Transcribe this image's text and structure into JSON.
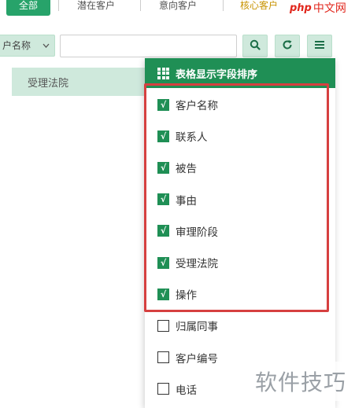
{
  "tabs": {
    "all": "全部",
    "potential": "潜在客户",
    "intent": "意向客户",
    "core": "核心客户"
  },
  "watermark_top": {
    "php": "php",
    "cn": "中文网"
  },
  "search": {
    "field_select": "户名称",
    "input_value": "",
    "search_icon": "search-icon",
    "refresh_icon": "refresh-icon",
    "columns_icon": "list-icon"
  },
  "table": {
    "header_col": "受理法院"
  },
  "panel": {
    "title": "表格显示字段排序",
    "items": [
      {
        "label": "客户名称",
        "checked": true
      },
      {
        "label": "联系人",
        "checked": true
      },
      {
        "label": "被告",
        "checked": true
      },
      {
        "label": "事由",
        "checked": true
      },
      {
        "label": "审理阶段",
        "checked": true
      },
      {
        "label": "受理法院",
        "checked": true
      },
      {
        "label": "操作",
        "checked": true
      },
      {
        "label": "归属同事",
        "checked": false
      },
      {
        "label": "客户编号",
        "checked": false
      },
      {
        "label": "电话",
        "checked": false
      }
    ]
  },
  "watermark_bottom": "软件技巧",
  "colors": {
    "primary_green": "#1f8f55",
    "light_green": "#cfe9dc",
    "highlight_red": "#d64040",
    "core_gold": "#c89300"
  }
}
